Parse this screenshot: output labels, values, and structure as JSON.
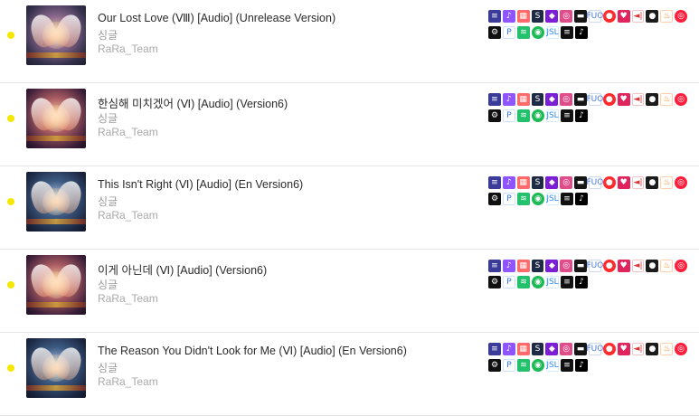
{
  "items": [
    {
      "title": "Our Lost Love (Ⅷ) [Audio] (Unrelease Version)",
      "type": "싱글",
      "artist": "RaRa_Team",
      "cover": "cover"
    },
    {
      "title": "한심해 미치겠어 (Ⅵ) [Audio] (Version6)",
      "type": "싱글",
      "artist": "RaRa_Team",
      "cover": "cover alt2"
    },
    {
      "title": "This Isn't Right (Ⅵ) [Audio] (En Version6)",
      "type": "싱글",
      "artist": "RaRa_Team",
      "cover": "cover alt"
    },
    {
      "title": "이게 아닌데 (Ⅵ) [Audio] (Version6)",
      "type": "싱글",
      "artist": "RaRa_Team",
      "cover": "cover alt2"
    },
    {
      "title": "The Reason You Didn't Look for Me (Ⅵ) [Audio] (En Version6)",
      "type": "싱글",
      "artist": "RaRa_Team",
      "cover": "cover alt"
    }
  ],
  "platform_icons": {
    "row1": [
      {
        "name": "spotify-like-icon",
        "bg": "#3b3b98",
        "glyph": "≡"
      },
      {
        "name": "apple-music-icon",
        "bg": "#8f56ff",
        "glyph": "♪"
      },
      {
        "name": "deezer-icon",
        "bg": "#ff6b6b",
        "glyph": "▦"
      },
      {
        "name": "shazam-icon",
        "bg": "#1f2a44",
        "glyph": "S"
      },
      {
        "name": "tidal-icon",
        "bg": "#7a1fd6",
        "glyph": "◆"
      },
      {
        "name": "instagram-icon",
        "bg": "#e14d8b",
        "glyph": "◎"
      },
      {
        "name": "youtube-music-icon",
        "bg": "#151515",
        "glyph": "▬"
      },
      {
        "name": "fluo-icon",
        "bg": "#ffffff",
        "glyph": "FUO",
        "fg": "#4a7bd8",
        "border": "#cfd8ef"
      },
      {
        "name": "youtube-icon",
        "bg": "#ff2b2b",
        "glyph": "●",
        "round": true
      },
      {
        "name": "iheart-icon",
        "bg": "#e0245e",
        "glyph": "♥"
      },
      {
        "name": "radio-icon",
        "bg": "#ffffff",
        "glyph": "◄|",
        "fg": "#d33",
        "border": "#f2c3c3"
      },
      {
        "name": "sound-icon",
        "bg": "#1b1b1b",
        "glyph": "●"
      },
      {
        "name": "fire-icon",
        "bg": "#ffffff",
        "glyph": "♨",
        "fg": "#ff7a00",
        "border": "#ffd0a8"
      },
      {
        "name": "target-icon",
        "bg": "#ff1f3d",
        "glyph": "◎",
        "round": true
      }
    ],
    "row2": [
      {
        "name": "gear-icon",
        "bg": "#101010",
        "glyph": "⚙"
      },
      {
        "name": "pandora-icon",
        "bg": "#ffffff",
        "glyph": "P",
        "fg": "#2a6fff",
        "border": "#cfe0ff"
      },
      {
        "name": "anghami-icon",
        "bg": "#23c06e",
        "glyph": "≋"
      },
      {
        "name": "spotify-icon",
        "bg": "#1db954",
        "glyph": "◉",
        "round": true
      },
      {
        "name": "jiosaavn-icon",
        "bg": "#ffffff",
        "glyph": "JSL",
        "fg": "#2a8cff",
        "border": "#d9ecff"
      },
      {
        "name": "napster-icon",
        "bg": "#111111",
        "glyph": "≡"
      },
      {
        "name": "tiktok-icon",
        "bg": "#000000",
        "glyph": "♪"
      }
    ]
  }
}
